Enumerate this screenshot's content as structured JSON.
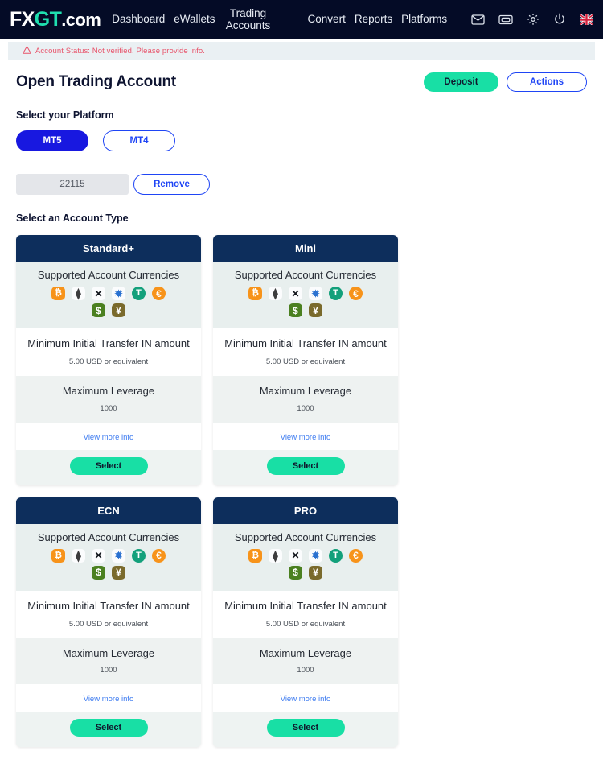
{
  "brand": {
    "logo_fx": "FX",
    "logo_gt": "GT",
    "logo_dotcom": ".com",
    "accent_teal": "#1fe0b0",
    "navy": "#0d2e5c",
    "navbar_bg": "#040b26",
    "blue": "#1f45f5"
  },
  "navbar": {
    "links": [
      {
        "label": "Dashboard",
        "name": "dashboard"
      },
      {
        "label": "eWallets",
        "name": "ewallets"
      },
      {
        "label": "Trading Accounts",
        "name": "trading-accounts"
      },
      {
        "label": "Convert",
        "name": "convert"
      },
      {
        "label": "Reports",
        "name": "reports"
      },
      {
        "label": "Platforms",
        "name": "platforms"
      }
    ],
    "icons": [
      {
        "name": "mail-icon",
        "glyph": "envelope"
      },
      {
        "name": "ticket-icon",
        "glyph": "ticket"
      },
      {
        "name": "gear-icon",
        "glyph": "gear"
      },
      {
        "name": "power-icon",
        "glyph": "power"
      },
      {
        "name": "flag-icon",
        "glyph": "uk-flag"
      }
    ]
  },
  "alert": {
    "icon": "warning-triangle-icon",
    "text": "Account Status: Not verified. Please provide info.",
    "color": "#e8546b"
  },
  "header": {
    "title": "Open Trading Account",
    "deposit_label": "Deposit",
    "actions_label": "Actions"
  },
  "platform": {
    "label": "Select your Platform",
    "options": [
      {
        "label": "MT5",
        "selected": true
      },
      {
        "label": "MT4",
        "selected": false
      }
    ]
  },
  "account": {
    "value": "22115",
    "placeholder": "Account number",
    "remove_label": "Remove"
  },
  "account_type": {
    "label": "Select an Account Type",
    "currencies_title": "Supported Account Currencies",
    "min_transfer_title": "Minimum Initial Transfer IN amount",
    "min_transfer_value": "5.00 USD or equivalent",
    "leverage_title": "Maximum Leverage",
    "leverage_value": "1000",
    "view_more_label": "View more info",
    "select_label": "Select",
    "currencies_row1": [
      {
        "name": "bitcoin-icon",
        "symbol": "₿",
        "cls": "btc"
      },
      {
        "name": "ethereum-icon",
        "symbol": "⧫",
        "cls": "eth"
      },
      {
        "name": "xrp-icon",
        "symbol": "✕",
        "cls": "xrp"
      },
      {
        "name": "cardano-icon",
        "symbol": "✹",
        "cls": "ada"
      },
      {
        "name": "tether-icon",
        "symbol": "T",
        "cls": "usdt circ"
      },
      {
        "name": "euro-icon",
        "symbol": "€",
        "cls": "eur circ"
      }
    ],
    "currencies_row2": [
      {
        "name": "usd-icon",
        "symbol": "$",
        "cls": "usd"
      },
      {
        "name": "jpy-icon",
        "symbol": "¥",
        "cls": "jpy"
      }
    ],
    "cards": [
      {
        "name": "standard-plus",
        "title": "Standard+"
      },
      {
        "name": "mini",
        "title": "Mini"
      },
      {
        "name": "ecn",
        "title": "ECN"
      },
      {
        "name": "pro",
        "title": "PRO"
      }
    ]
  }
}
